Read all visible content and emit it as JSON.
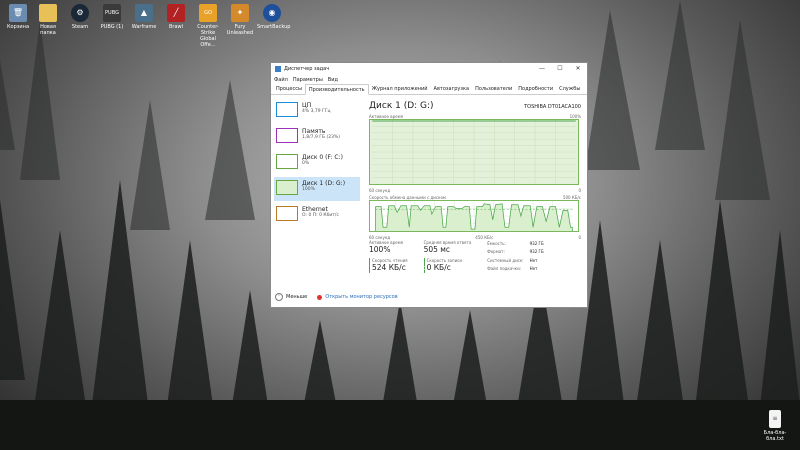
{
  "desktop": {
    "icons": [
      {
        "label": "Корзина",
        "icon": "recycle-bin-icon",
        "color": "#6c8bb0"
      },
      {
        "label": "Новая папка",
        "icon": "folder-icon",
        "color": "#e7c158"
      },
      {
        "label": "Steam",
        "icon": "steam-icon",
        "color": "#1b2838"
      },
      {
        "label": "PUBG (1)",
        "icon": "pubg-icon",
        "color": "#3a3a3a"
      },
      {
        "label": "Warframe",
        "icon": "warframe-icon",
        "color": "#4a6f8a"
      },
      {
        "label": "Brawl",
        "icon": "brawl-icon",
        "color": "#b22222"
      },
      {
        "label": "Counter-Strike Global Offe...",
        "icon": "csgo-icon",
        "color": "#e8a22a"
      },
      {
        "label": "Fury Unleashed",
        "icon": "game-icon",
        "color": "#d4892a"
      },
      {
        "label": "SmartBackup",
        "icon": "backup-icon",
        "color": "#1e4f9a"
      }
    ],
    "corner_file": {
      "label": "Бла-бла-бла.txt",
      "icon": "document-icon"
    }
  },
  "window": {
    "title": "Диспетчер задач",
    "menu": [
      "Файл",
      "Параметры",
      "Вид"
    ],
    "tabs": [
      "Процессы",
      "Производительность",
      "Журнал приложений",
      "Автозагрузка",
      "Пользователи",
      "Подробности",
      "Службы"
    ],
    "active_tab": 1,
    "controls": {
      "minimize": "—",
      "maximize": "☐",
      "close": "✕"
    },
    "sidebar": [
      {
        "name": "ЦП",
        "sub": "4% 3,79 ГГц",
        "color": "#1c8ed9"
      },
      {
        "name": "Память",
        "sub": "1,8/7,9 ГБ (23%)",
        "color": "#9a33b5"
      },
      {
        "name": "Диск 0 (F: C:)",
        "sub": "0%",
        "color": "#66a644"
      },
      {
        "name": "Диск 1 (D: G:)",
        "sub": "100%",
        "color": "#66a644"
      },
      {
        "name": "Ethernet",
        "sub": "О: 0 П: 0 Кбит/с",
        "color": "#b77a2a"
      }
    ],
    "selected_item": 3,
    "detail": {
      "title": "Диск 1 (D: G:)",
      "model": "TOSHIBA DT01ACA100",
      "graph1": {
        "label": "Активное время",
        "max": "100%",
        "time": "60 секунд",
        "min": "0"
      },
      "graph2": {
        "label": "Скорость обмена данными с диском",
        "max": "500 КБ/с",
        "ref": "450 КБ/с",
        "time": "60 секунд",
        "min": "0"
      },
      "stats": {
        "active_label": "Активное время",
        "active_value": "100%",
        "resp_label": "Средняя время ответа",
        "resp_value": "505 мс",
        "read_label": "Скорость чтения",
        "read_value": "524 КБ/с",
        "write_label": "Скорость записи",
        "write_value": "0 КБ/с"
      },
      "props": [
        {
          "k": "Ёмкость:",
          "v": "932 ГБ"
        },
        {
          "k": "Формат:",
          "v": "932 ГБ"
        },
        {
          "k": "Системный диск:",
          "v": "Нет"
        },
        {
          "k": "Файл подкачки:",
          "v": "Нет"
        }
      ]
    },
    "footer": {
      "less": "Меньше",
      "monitor": "Открыть монитор ресурсов"
    }
  }
}
